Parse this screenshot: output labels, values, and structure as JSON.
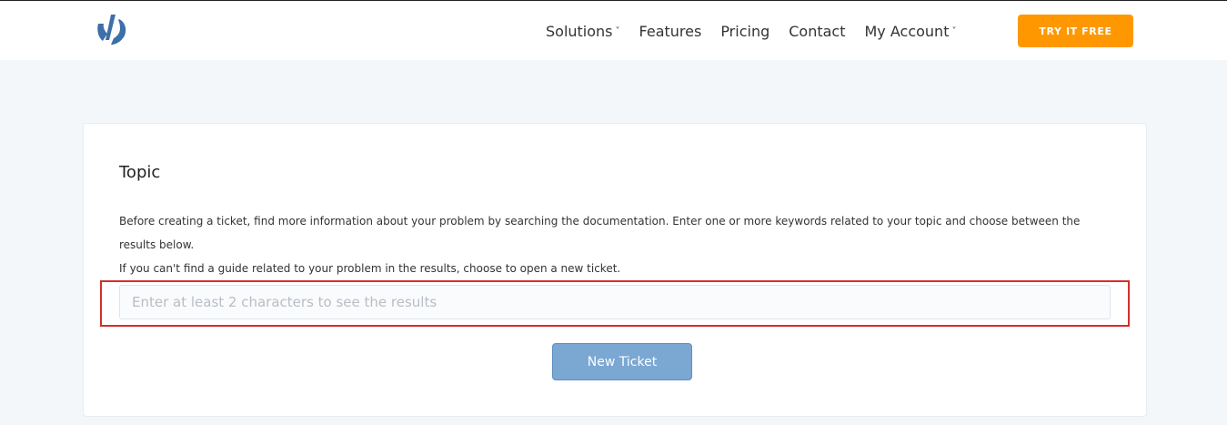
{
  "header": {
    "nav": [
      {
        "label": "Solutions",
        "has_dropdown": true
      },
      {
        "label": "Features",
        "has_dropdown": false
      },
      {
        "label": "Pricing",
        "has_dropdown": false
      },
      {
        "label": "Contact",
        "has_dropdown": false
      },
      {
        "label": "My Account",
        "has_dropdown": true
      }
    ],
    "cta_label": "TRY IT FREE",
    "dropdown_chevron": "˅"
  },
  "topic": {
    "title": "Topic",
    "description_line1": "Before creating a ticket, find more information about your problem by searching the documentation. Enter one or more keywords related to your topic and choose between the results below.",
    "description_line2": "If you can't find a guide related to your problem in the results, choose to open a new ticket.",
    "search_placeholder": "Enter at least 2 characters to see the results",
    "search_value": "",
    "new_ticket_label": "New Ticket"
  },
  "colors": {
    "cta": "#ff9800",
    "new_ticket_button": "#7ba7d3",
    "highlight": "#d32f2f",
    "logo": "#3d6fa8"
  },
  "icons": {
    "logo": "brand-logo-icon",
    "chevron": "chevron-down-icon"
  }
}
